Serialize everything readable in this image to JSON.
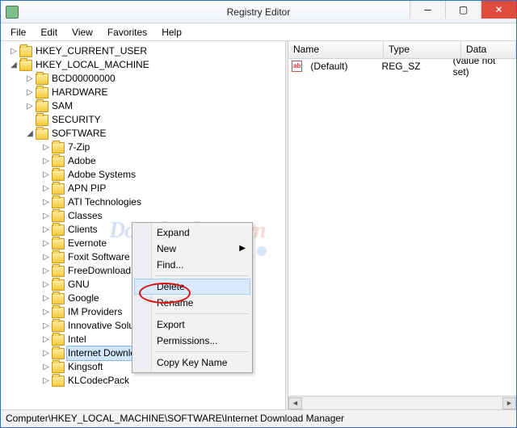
{
  "title": "Registry Editor",
  "menus": {
    "file": "File",
    "edit": "Edit",
    "view": "View",
    "favorites": "Favorites",
    "help": "Help"
  },
  "tree": {
    "hkcu": "HKEY_CURRENT_USER",
    "hklm": "HKEY_LOCAL_MACHINE",
    "bcd": "BCD00000000",
    "hw": "HARDWARE",
    "sam": "SAM",
    "sec": "SECURITY",
    "sw": "SOFTWARE",
    "items": [
      "7-Zip",
      "Adobe",
      "Adobe Systems",
      "APN PIP",
      "ATI Technologies",
      "Classes",
      "Clients",
      "Evernote",
      "Foxit Software",
      "FreeDownloadManager.ORG",
      "GNU",
      "Google",
      "IM Providers",
      "Innovative Solutions",
      "Intel",
      "Internet Download Manager",
      "Kingsoft",
      "KLCodecPack"
    ]
  },
  "list": {
    "cols": {
      "name": "Name",
      "type": "Type",
      "data": "Data"
    },
    "row": {
      "name": "(Default)",
      "type": "REG_SZ",
      "data": "(value not set)"
    }
  },
  "ctx": {
    "expand": "Expand",
    "new": "New",
    "find": "Find...",
    "delete": "Delete",
    "rename": "Rename",
    "export": "Export",
    "perm": "Permissions...",
    "copy": "Copy Key Name"
  },
  "status": "Computer\\HKEY_LOCAL_MACHINE\\SOFTWARE\\Internet Download Manager",
  "watermark": {
    "a": "Download",
    "b": ".com.vn"
  },
  "dot_colors": [
    "#6bbf5b",
    "#5ac3e0",
    "#f2c24a",
    "#e86a5a",
    "#5a9ae8"
  ]
}
